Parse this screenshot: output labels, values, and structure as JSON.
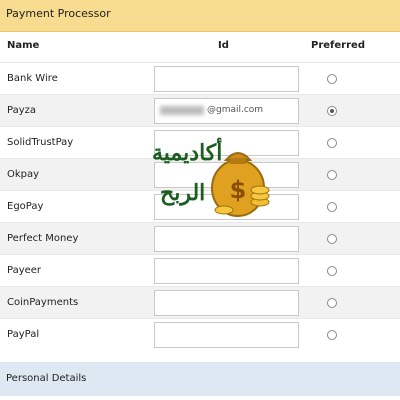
{
  "header": {
    "title": "Payment Processor"
  },
  "columns": {
    "name": "Name",
    "id": "Id",
    "preferred": "Preferred"
  },
  "rows": [
    {
      "name": "Bank Wire",
      "id_value": "",
      "preferred": false
    },
    {
      "name": "Payza",
      "id_value": "@gmail.com",
      "preferred": true
    },
    {
      "name": "SolidTrustPay",
      "id_value": "",
      "preferred": false
    },
    {
      "name": "Okpay",
      "id_value": "",
      "preferred": false
    },
    {
      "name": "EgoPay",
      "id_value": "",
      "preferred": false
    },
    {
      "name": "Perfect Money",
      "id_value": "",
      "preferred": false
    },
    {
      "name": "Payeer",
      "id_value": "",
      "preferred": false
    },
    {
      "name": "CoinPayments",
      "id_value": "",
      "preferred": false
    },
    {
      "name": "PayPal",
      "id_value": "",
      "preferred": false
    }
  ],
  "section": {
    "title": "Personal Details"
  },
  "watermark": {
    "line1": "أكاديمية",
    "line2": "الربح"
  },
  "colors": {
    "header_bg": "#f7dc8f",
    "section_bg": "#dde8f2",
    "alt_row_bg": "#f2f2f2"
  }
}
